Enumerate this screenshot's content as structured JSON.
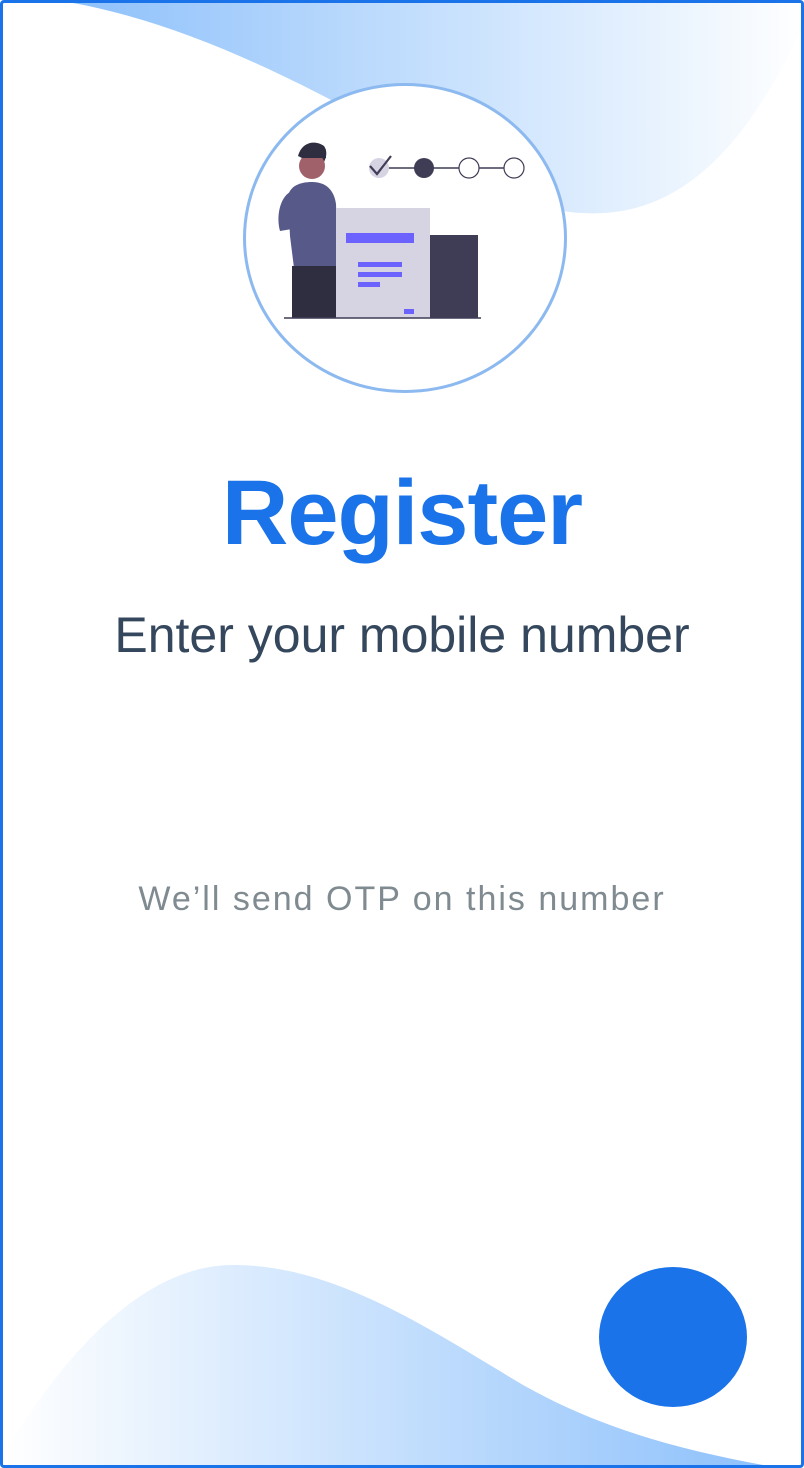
{
  "screen": {
    "title": "Register",
    "subtitle": "Enter your mobile number",
    "hint": "We’ll send OTP on this number"
  },
  "mobile_input": {
    "value": "",
    "placeholder": ""
  },
  "progress": {
    "total_steps": 4,
    "completed_steps": 1,
    "current_step": 2
  },
  "colors": {
    "accent": "#1a73e8",
    "subtitle": "#34475c",
    "hint": "#7f8b90",
    "wave": "#8ec1fb",
    "illustration_ring": "#8cb9ef"
  },
  "icons": {
    "illustration": "person-with-registration-form-illustration",
    "next_button": "next-step-circle"
  }
}
